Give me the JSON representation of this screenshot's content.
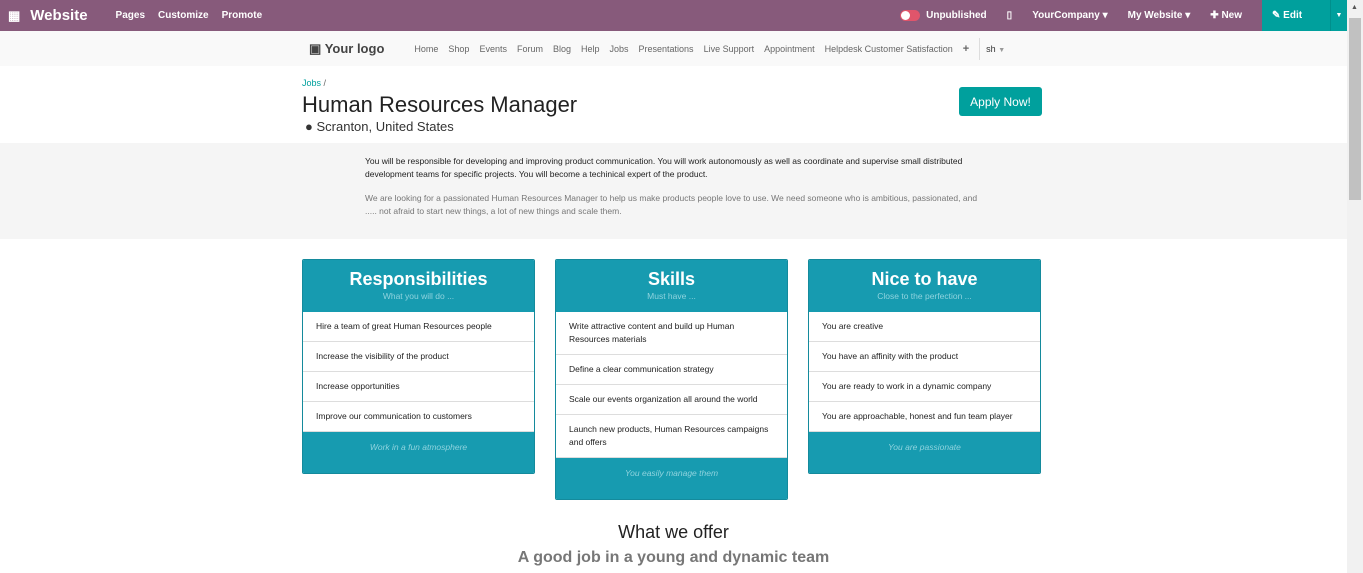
{
  "topbar": {
    "app": "Website",
    "menus": [
      "Pages",
      "Customize",
      "Promote"
    ],
    "status": "Unpublished",
    "company": "YourCompany",
    "website": "My Website",
    "new": "New",
    "edit": "Edit"
  },
  "nav": {
    "logo": "Your logo",
    "links": [
      "Home",
      "Shop",
      "Events",
      "Forum",
      "Blog",
      "Help",
      "Jobs",
      "Presentations",
      "Live Support",
      "Appointment",
      "Helpdesk Customer Satisfaction"
    ],
    "plus": "+",
    "user": "sh"
  },
  "job": {
    "crumb": "Jobs",
    "crumb_sep": "/",
    "title": "Human Resources Manager",
    "location": "Scranton, United States",
    "apply": "Apply Now!"
  },
  "description": [
    "You will be responsible for developing and improving product communication. You will work autonomously as well as coordinate and supervise small distributed development teams for specific projects. You will become a techinical expert of the product.",
    "We are looking for a passionated Human Resources Manager to help us make products people love to use. We need someone who is ambitious, passionated, and ..... not afraid to start new things, a lot of new things and scale them."
  ],
  "cards": [
    {
      "title": "Responsibilities",
      "subtitle": "What you will do ...",
      "items": [
        "Hire a team of great Human Resources people",
        "Increase the visibility of the product",
        "Increase opportunities",
        "Improve our communication to customers"
      ],
      "footer": "Work in a fun atmosphere"
    },
    {
      "title": "Skills",
      "subtitle": "Must have ...",
      "items": [
        "Write attractive content and build up Human Resources materials",
        "Define a clear communication strategy",
        "Scale our events organization all around the world",
        "Launch new products, Human Resources campaigns and offers"
      ],
      "footer": "You easily manage them"
    },
    {
      "title": "Nice to have",
      "subtitle": "Close to the perfection ...",
      "items": [
        "You are creative",
        "You have an affinity with the product",
        "You are ready to work in a dynamic company",
        "You are approachable, honest and fun team player"
      ],
      "footer": "You are passionate"
    }
  ],
  "offer": {
    "title": "What we offer",
    "subtitle": "A good job in a young and dynamic team"
  },
  "colors": {
    "topbar": "#875a7b",
    "accent": "#00a09d",
    "card": "#179bb0"
  }
}
